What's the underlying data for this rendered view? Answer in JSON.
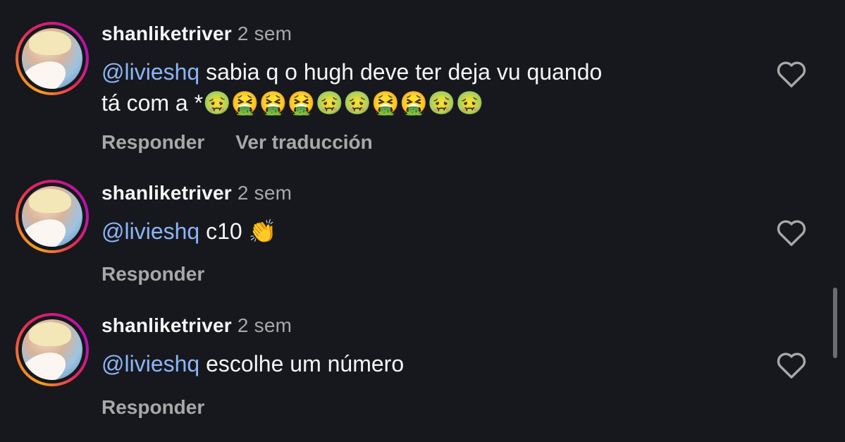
{
  "comments": [
    {
      "username": "shanliketriver",
      "time": "2 sem",
      "mention": "@livieshq",
      "text_line1": " sabia q o hugh deve ter deja vu quando",
      "text_line2": "tá com a *",
      "emojis": "🤢🤮🤮🤮🤢🤢🤮🤮🤢🤢",
      "reply_label": "Responder",
      "translate_label": "Ver traducción"
    },
    {
      "username": "shanliketriver",
      "time": "2 sem",
      "mention": "@livieshq",
      "text_line1": " c10 ",
      "emojis": "👏",
      "reply_label": "Responder"
    },
    {
      "username": "shanliketriver",
      "time": "2 sem",
      "mention": "@livieshq",
      "text_line1": " escolhe um número",
      "reply_label": "Responder"
    }
  ],
  "colors": {
    "background": "#16181d",
    "mention": "#8db4f7",
    "secondary_text": "#a8a8a8",
    "primary_text": "#f5f5f5"
  },
  "icons": {
    "like": "heart-outline-icon"
  }
}
